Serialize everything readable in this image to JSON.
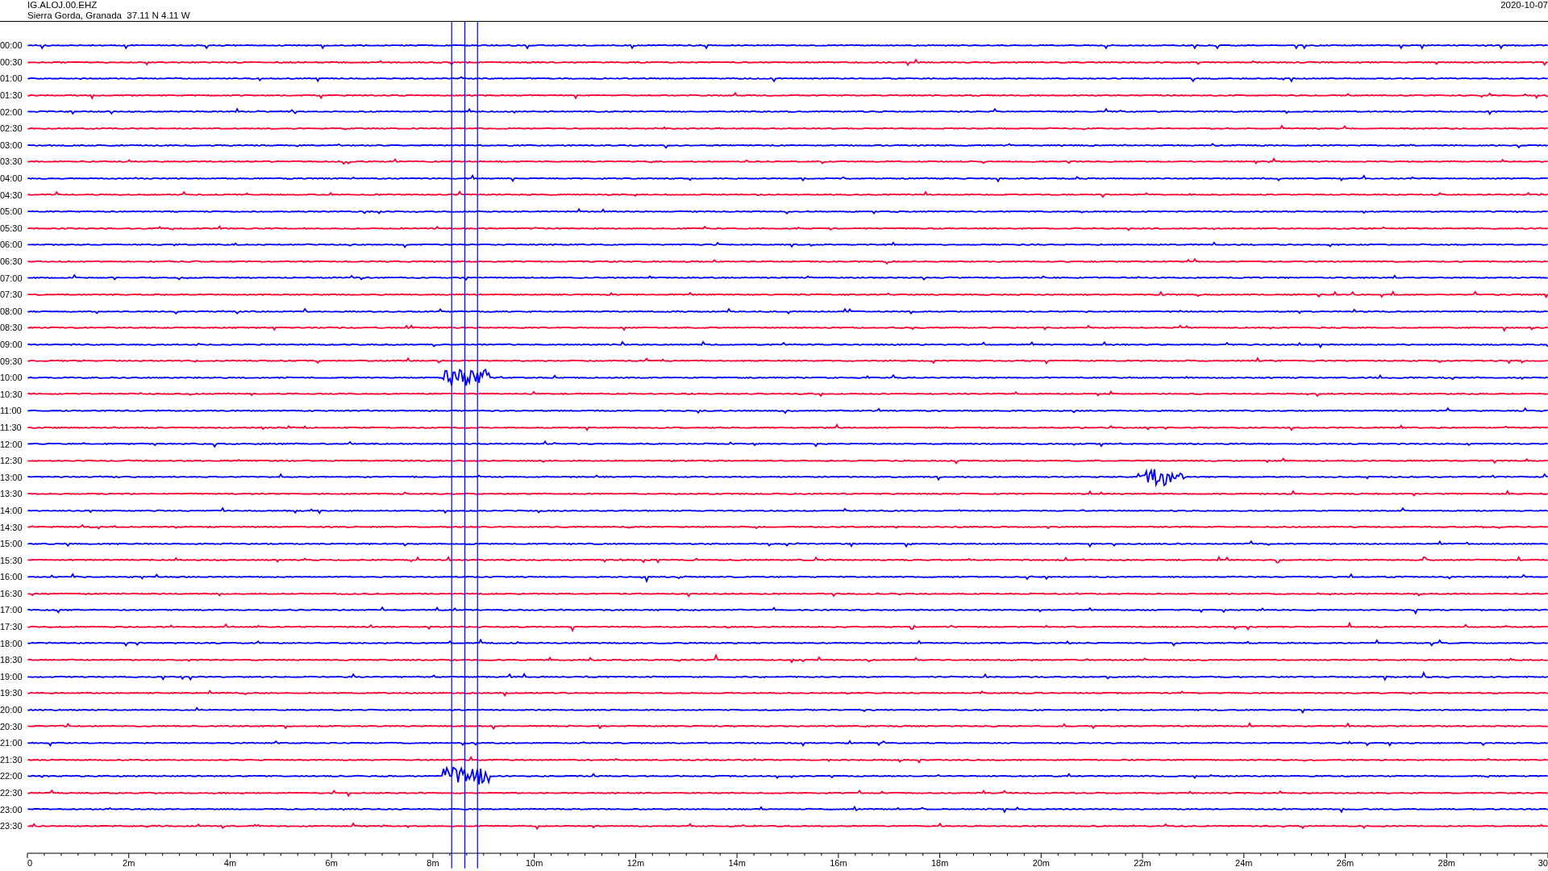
{
  "header": {
    "station": "IG.ALOJ.00.EHZ",
    "location": "Sierra Gorda, Granada  37.11 N 4.11 W",
    "date": "2020-10-07"
  },
  "rows": [
    {
      "time": "00:00",
      "color": "#0000ff"
    },
    {
      "time": "00:30",
      "color": "#ff0033"
    },
    {
      "time": "01:00",
      "color": "#0000ff"
    },
    {
      "time": "01:30",
      "color": "#ff0033"
    },
    {
      "time": "02:00",
      "color": "#0000ff"
    },
    {
      "time": "02:30",
      "color": "#ff0033"
    },
    {
      "time": "03:00",
      "color": "#0000ff"
    },
    {
      "time": "03:30",
      "color": "#ff0033"
    },
    {
      "time": "04:00",
      "color": "#0000ff"
    },
    {
      "time": "04:30",
      "color": "#ff0033"
    },
    {
      "time": "05:00",
      "color": "#0000ff"
    },
    {
      "time": "05:30",
      "color": "#ff0033"
    },
    {
      "time": "06:00",
      "color": "#0000ff"
    },
    {
      "time": "06:30",
      "color": "#ff0033"
    },
    {
      "time": "07:00",
      "color": "#0000ff"
    },
    {
      "time": "07:30",
      "color": "#ff0033"
    },
    {
      "time": "08:00",
      "color": "#0000ff"
    },
    {
      "time": "08:30",
      "color": "#ff0033"
    },
    {
      "time": "09:00",
      "color": "#0000ff"
    },
    {
      "time": "09:30",
      "color": "#ff0033"
    },
    {
      "time": "10:00",
      "color": "#0000ff"
    },
    {
      "time": "10:30",
      "color": "#ff0033"
    },
    {
      "time": "11:00",
      "color": "#0000ff"
    },
    {
      "time": "11:30",
      "color": "#ff0033"
    },
    {
      "time": "12:00",
      "color": "#0000ff"
    },
    {
      "time": "12:30",
      "color": "#ff0033"
    },
    {
      "time": "13:00",
      "color": "#0000ff"
    },
    {
      "time": "13:30",
      "color": "#ff0033"
    },
    {
      "time": "14:00",
      "color": "#0000ff"
    },
    {
      "time": "14:30",
      "color": "#ff0033"
    },
    {
      "time": "15:00",
      "color": "#0000ff"
    },
    {
      "time": "15:30",
      "color": "#ff0033"
    },
    {
      "time": "16:00",
      "color": "#0000ff"
    },
    {
      "time": "16:30",
      "color": "#ff0033"
    },
    {
      "time": "17:00",
      "color": "#0000ff"
    },
    {
      "time": "17:30",
      "color": "#ff0033"
    },
    {
      "time": "18:00",
      "color": "#0000ff"
    },
    {
      "time": "18:30",
      "color": "#ff0033"
    },
    {
      "time": "19:00",
      "color": "#0000ff"
    },
    {
      "time": "19:30",
      "color": "#ff0033"
    },
    {
      "time": "20:00",
      "color": "#0000ff"
    },
    {
      "time": "20:30",
      "color": "#ff0033"
    },
    {
      "time": "21:00",
      "color": "#0000ff"
    },
    {
      "time": "21:30",
      "color": "#ff0033"
    },
    {
      "time": "22:00",
      "color": "#0000ff"
    },
    {
      "time": "22:30",
      "color": "#ff0033"
    },
    {
      "time": "23:00",
      "color": "#0000ff"
    },
    {
      "time": "23:30",
      "color": "#ff0033"
    }
  ],
  "axis": {
    "ticks": [
      "0",
      "2m",
      "4m",
      "6m",
      "8m",
      "10m",
      "12m",
      "14m",
      "16m",
      "18m",
      "20m",
      "22m",
      "24m",
      "26m",
      "28m",
      "30"
    ]
  }
}
